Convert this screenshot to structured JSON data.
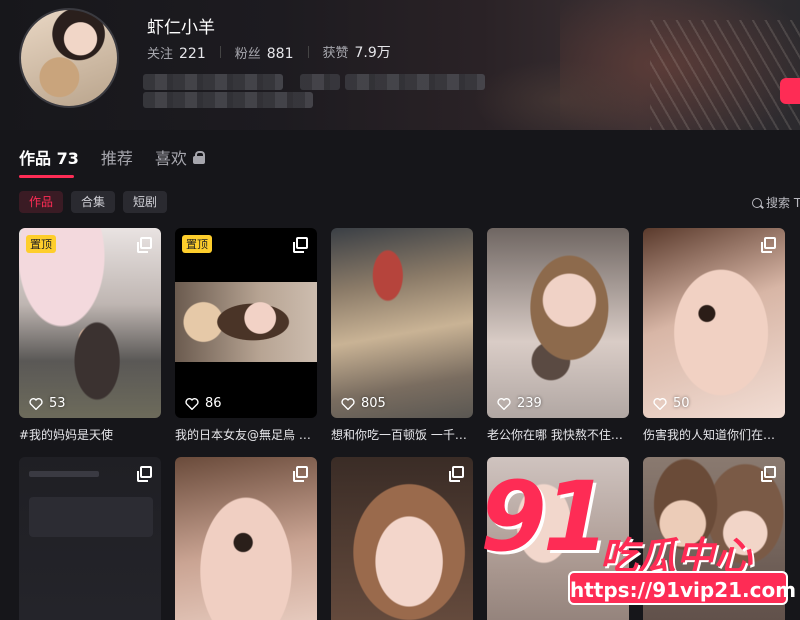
{
  "profile": {
    "username": "虾仁小羊",
    "stats": [
      {
        "label": "关注",
        "value": "221"
      },
      {
        "label": "粉丝",
        "value": "881"
      },
      {
        "label": "获赞",
        "value": "7.9万"
      }
    ]
  },
  "tabs": [
    {
      "label": "作品 73",
      "active": true
    },
    {
      "label": "推荐",
      "active": false
    },
    {
      "label": "喜欢",
      "active": false,
      "icon": "lock-icon"
    }
  ],
  "chips": [
    {
      "label": "作品",
      "active": true
    },
    {
      "label": "合集",
      "active": false
    },
    {
      "label": "短剧",
      "active": false
    }
  ],
  "search": {
    "label": "搜索 T"
  },
  "videos": [
    {
      "pinned": "置顶",
      "likes": "53",
      "caption": "#我的妈妈是天使",
      "multi": true
    },
    {
      "pinned": "置顶",
      "likes": "86",
      "caption": "我的日本女友@無足烏 …",
      "multi": true
    },
    {
      "pinned": "",
      "likes": "805",
      "caption": "想和你吃一百顿饭 一千…",
      "multi": false
    },
    {
      "pinned": "",
      "likes": "239",
      "caption": "老公你在哪 我快熬不住…",
      "multi": false
    },
    {
      "pinned": "",
      "likes": "50",
      "caption": "伤害我的人知道你们在…",
      "multi": true
    },
    {
      "pinned": "",
      "likes": "",
      "caption": "",
      "multi": true
    },
    {
      "pinned": "",
      "likes": "",
      "caption": "",
      "multi": true
    },
    {
      "pinned": "",
      "likes": "",
      "caption": "",
      "multi": true
    },
    {
      "pinned": "",
      "likes": "",
      "caption": "",
      "multi": false
    },
    {
      "pinned": "",
      "likes": "",
      "caption": "",
      "multi": true
    }
  ],
  "watermark": {
    "number": "91",
    "text": "吃瓜中心",
    "url": "https://91vip21.com"
  },
  "colors": {
    "accent": "#fe2c55",
    "pin": "#fece2c",
    "background": "#16161a"
  }
}
